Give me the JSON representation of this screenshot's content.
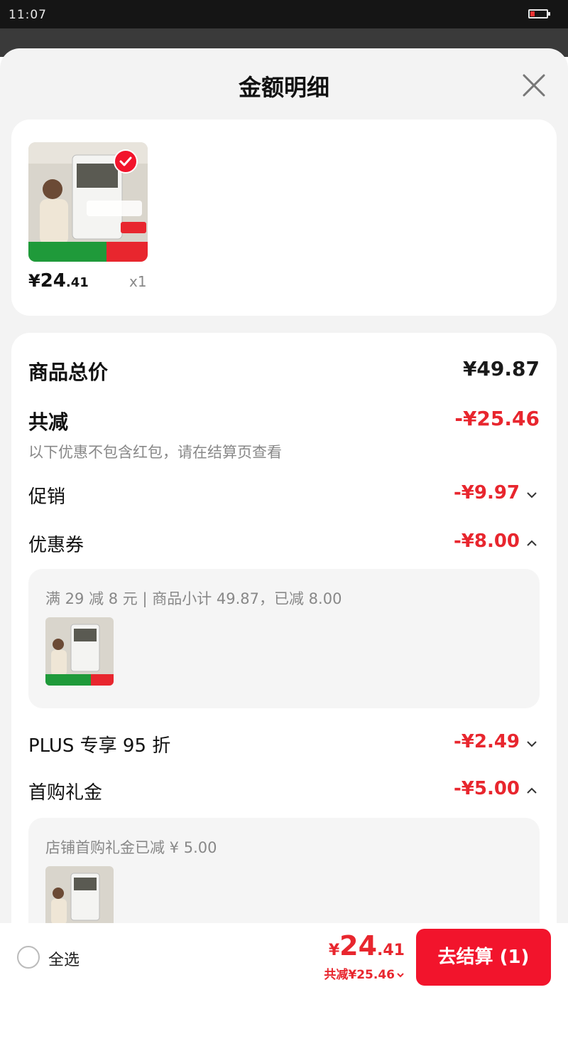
{
  "status_bar": {
    "time": "11:07"
  },
  "sheet": {
    "title": "金额明细"
  },
  "product": {
    "price_symbol": "¥",
    "price_int": "24",
    "price_dec": ".41",
    "quantity": "x1"
  },
  "breakdown": {
    "total_label": "商品总价",
    "total_value": "¥49.87",
    "reduce_label": "共减",
    "reduce_value": "-¥25.46",
    "reduce_note": "以下优惠不包含红包，请在结算页查看",
    "promo_label": "促销",
    "promo_value": "-¥9.97",
    "coupon_label": "优惠券",
    "coupon_value": "-¥8.00",
    "coupon_detail": "满 29 减 8 元 | 商品小计 49.87，已减 8.00",
    "plus_label": "PLUS 专享 95 折",
    "plus_value": "-¥2.49",
    "gift_label": "首购礼金",
    "gift_value": "-¥5.00",
    "gift_detail": "店铺首购礼金已减 ¥ 5.00"
  },
  "bottom_bar": {
    "select_all": "全选",
    "total_symbol": "¥",
    "total_int": "24",
    "total_dec": ".41",
    "saved": "共减¥25.46",
    "checkout": "去结算 (1)"
  },
  "colors": {
    "accent": "#f2142c",
    "discount_text": "#e8262e"
  }
}
